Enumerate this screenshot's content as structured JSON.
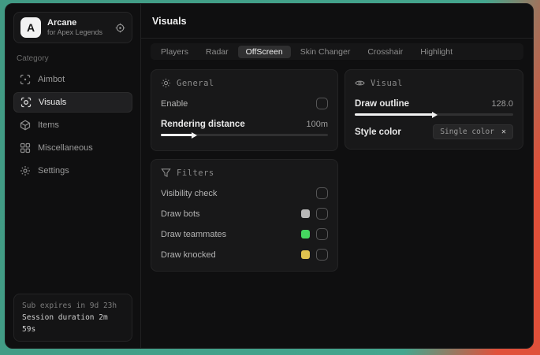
{
  "window": {
    "logo_letter": "A",
    "app_title": "Arcane",
    "app_subtitle": "for Apex Legends"
  },
  "sidebar": {
    "category_label": "Category",
    "items": [
      {
        "label": "Aimbot",
        "icon": "crosshair-icon",
        "selected": false
      },
      {
        "label": "Visuals",
        "icon": "focus-eye-icon",
        "selected": true
      },
      {
        "label": "Items",
        "icon": "box-icon",
        "selected": false
      },
      {
        "label": "Miscellaneous",
        "icon": "grid-icon",
        "selected": false
      },
      {
        "label": "Settings",
        "icon": "gear-icon",
        "selected": false
      }
    ],
    "footer": {
      "sub_expires": "Sub expires in 9d 23h",
      "session_duration": "Session duration 2m 59s"
    }
  },
  "header": {
    "title": "Visuals"
  },
  "tabs": {
    "items": [
      {
        "label": "Players",
        "selected": false
      },
      {
        "label": "Radar",
        "selected": false
      },
      {
        "label": "OffScreen",
        "selected": true
      },
      {
        "label": "Skin Changer",
        "selected": false
      },
      {
        "label": "Crosshair",
        "selected": false
      },
      {
        "label": "Highlight",
        "selected": false
      }
    ]
  },
  "panels": {
    "general": {
      "title": "General",
      "enable_label": "Enable",
      "enable_checked": false,
      "rendering_distance_label": "Rendering distance",
      "rendering_distance_value": "100m",
      "rendering_distance_fill": "20%"
    },
    "visual": {
      "title": "Visual",
      "draw_outline_label": "Draw outline",
      "draw_outline_value": "128.0",
      "draw_outline_fill": "50%",
      "style_color_label": "Style color",
      "style_color_value": "Single color",
      "clear_icon": "✕"
    },
    "filters": {
      "title": "Filters",
      "rows": [
        {
          "label": "Visibility check",
          "swatch_color": null,
          "checked": false
        },
        {
          "label": "Draw bots",
          "swatch_color": "#b8b8b8",
          "checked": false
        },
        {
          "label": "Draw teammates",
          "swatch_color": "#45d55f",
          "checked": false
        },
        {
          "label": "Draw knocked",
          "swatch_color": "#dfc24f",
          "checked": false
        }
      ]
    }
  },
  "colors": {
    "background_teal": "#44a68e",
    "background_red": "#e0503a",
    "panel_bg": "#181819",
    "window_bg": "#0f0f10"
  }
}
